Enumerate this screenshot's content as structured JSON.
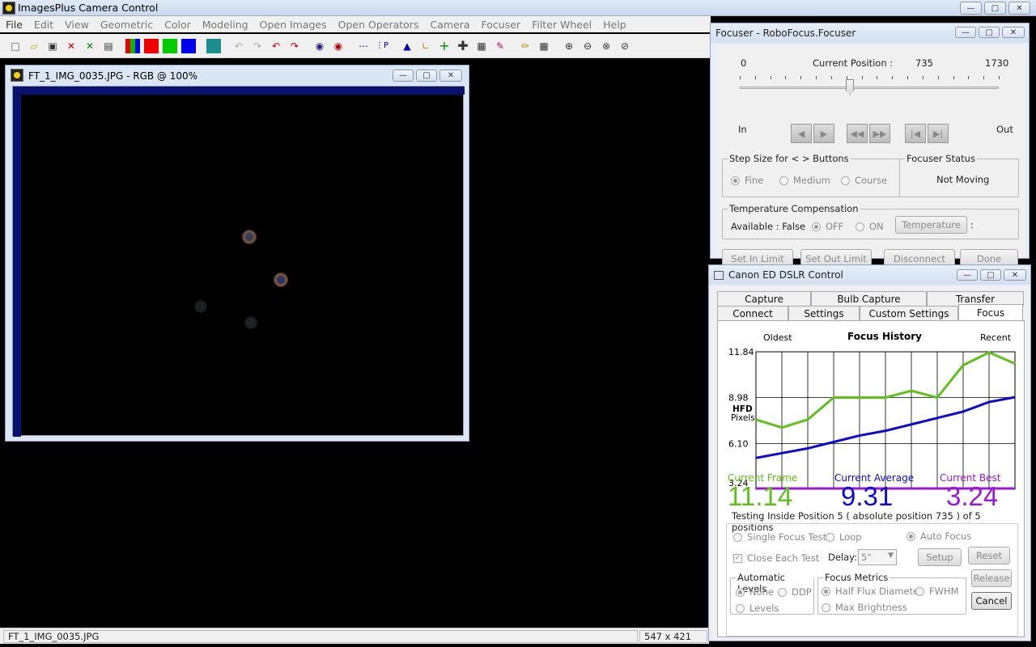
{
  "app": {
    "title": "ImagesPlus Camera Control"
  },
  "menu": [
    "File",
    "Edit",
    "View",
    "Geometric",
    "Color",
    "Modeling",
    "Open Images",
    "Open Operators",
    "Camera",
    "Focuser",
    "Filter Wheel",
    "Help"
  ],
  "image_window": {
    "title": "FT_1_IMG_0035.JPG - RGB @ 100%"
  },
  "status": {
    "filename": "FT_1_IMG_0035.JPG",
    "dimensions": "547 x 421"
  },
  "focuser": {
    "title": "Focuser - RoboFocus.Focuser",
    "min": "0",
    "max": "1730",
    "current_label": "Current Position :",
    "current_value": "735",
    "position_fraction": 0.4249,
    "in_label": "In",
    "out_label": "Out",
    "step_group": "Step Size for < > Buttons",
    "steps": [
      "Fine",
      "Medium",
      "Course"
    ],
    "status_group": "Focuser Status",
    "status_value": "Not Moving",
    "temp_group": "Temperature Compensation",
    "temp_available": "Available : False",
    "temp_off": "OFF",
    "temp_on": "ON",
    "temp_button": "Temperature",
    "temp_colon": ":",
    "buttons": {
      "set_in": "Set In Limit",
      "set_out": "Set Out Limit",
      "disconnect": "Disconnect",
      "done": "Done"
    }
  },
  "dslr": {
    "title": "Canon ED DSLR Control",
    "tabs_row1": [
      "Capture",
      "Bulb Capture",
      "Transfer"
    ],
    "tabs_row2": [
      "Connect",
      "Settings",
      "Custom Settings",
      "Focus"
    ],
    "current_frame_label": "Current Frame",
    "current_frame_value": "11.14",
    "current_avg_label": "Current Average",
    "current_avg_value": "9.31",
    "current_best_label": "Current Best",
    "current_best_value": "3.24",
    "testing_text": "Testing Inside Position 5 ( absolute position 735 ) of 5 positions",
    "single_focus": "Single Focus Test",
    "loop": "Loop",
    "auto_focus": "Auto Focus",
    "close_each": "Close Each Test",
    "delay_label": "Delay:",
    "delay_value": "5\"",
    "setup": "Setup",
    "reset": "Reset",
    "release": "Release",
    "cancel": "Cancel",
    "auto_levels_group": "Automatic Levels",
    "levels_none": "None",
    "levels_ddp": "DDP",
    "levels_levels": "Levels",
    "metrics_group": "Focus Metrics",
    "half_flux": "Half Flux Diameter",
    "fwhm": "FWHM",
    "max_brightness": "Max Brightness"
  },
  "colors": {
    "frame": "#5cc11a",
    "average": "#0a0ad0",
    "best": "#9a16d8"
  },
  "chart_data": {
    "type": "line",
    "title": "Focus History",
    "x_left_label": "Oldest",
    "x_right_label": "Recent",
    "ylabel": [
      "HFD",
      "Pixels"
    ],
    "yticks": [
      "11.84",
      "8.98",
      "6.10",
      "3.24"
    ],
    "ylim": [
      3.24,
      11.84
    ],
    "grid": true,
    "series": [
      {
        "name": "Current Frame",
        "color": "#5cc11a",
        "values": [
          7.6,
          7.1,
          7.6,
          8.98,
          8.98,
          8.98,
          9.4,
          8.98,
          11.0,
          11.8,
          11.1
        ]
      },
      {
        "name": "Current Average",
        "color": "#0a0ad0",
        "values": [
          5.2,
          5.5,
          5.8,
          6.2,
          6.6,
          6.9,
          7.3,
          7.7,
          8.1,
          8.7,
          9.0
        ]
      },
      {
        "name": "Current Best",
        "color": "#9a16d8",
        "values": [
          3.24,
          3.24,
          3.24,
          3.24,
          3.24,
          3.24,
          3.24,
          3.24,
          3.24,
          3.24,
          3.24
        ]
      }
    ]
  }
}
